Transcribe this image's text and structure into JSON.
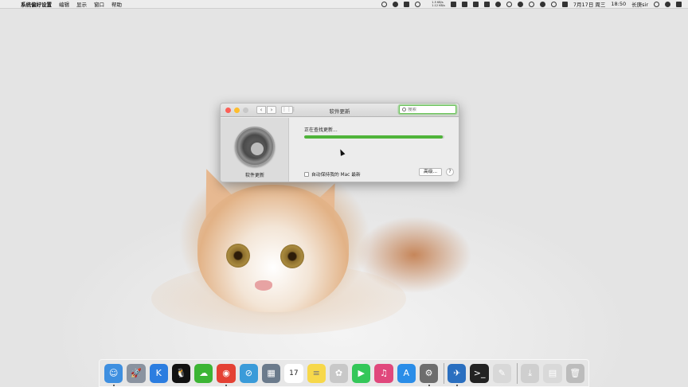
{
  "menubar": {
    "app_name": "系统偏好设置",
    "menus": [
      "编辑",
      "显示",
      "窗口",
      "帮助"
    ],
    "net_up": "1.5 KB/s",
    "net_down": "1.12 KB/s",
    "datetime": "7月17日 周三",
    "time": "18:50",
    "user": "长庚sir"
  },
  "window": {
    "title": "软件更新",
    "search_placeholder": "搜索",
    "pane_label": "软件更新",
    "status_text": "正在查找更新...",
    "progress": 0.99,
    "auto_update_label": "自动保持我的 Mac 最新",
    "advanced_label": "高级...",
    "help_label": "?"
  },
  "colors": {
    "progress_fill": "#4fb43a",
    "close": "#fc5f57",
    "minimize": "#fdbd2e"
  },
  "dock": {
    "items": [
      {
        "name": "finder-icon",
        "glyph": "☺",
        "color": "#3e8fe0",
        "running": true
      },
      {
        "name": "launchpad-icon",
        "glyph": "🚀",
        "color": "#8a93a0",
        "running": false
      },
      {
        "name": "klipper-icon",
        "glyph": "K",
        "color": "#2b7de0",
        "running": false
      },
      {
        "name": "qq-icon",
        "glyph": "🐧",
        "color": "#111111",
        "running": false
      },
      {
        "name": "wechat-icon",
        "glyph": "☁",
        "color": "#3cb534",
        "running": false
      },
      {
        "name": "chrome-icon",
        "glyph": "◉",
        "color": "#e44134",
        "running": true
      },
      {
        "name": "safari-icon",
        "glyph": "⊘",
        "color": "#3a9bd9",
        "running": false
      },
      {
        "name": "preview-icon",
        "glyph": "▦",
        "color": "#6b7b8c",
        "running": false
      },
      {
        "name": "calendar-icon",
        "glyph": "17",
        "color": "#ffffff",
        "running": false
      },
      {
        "name": "notes-icon",
        "glyph": "≡",
        "color": "#f7d84a",
        "running": false
      },
      {
        "name": "photos-icon",
        "glyph": "✿",
        "color": "#c8c8c8",
        "running": false
      },
      {
        "name": "facetime-icon",
        "glyph": "▶",
        "color": "#34c759",
        "running": false
      },
      {
        "name": "itunes-icon",
        "glyph": "♫",
        "color": "#e0487c",
        "running": false
      },
      {
        "name": "appstore-icon",
        "glyph": "A",
        "color": "#2a8de8",
        "running": false
      },
      {
        "name": "system-preferences-icon",
        "glyph": "⚙",
        "color": "#6d6d6d",
        "running": true
      },
      {
        "name": "sep"
      },
      {
        "name": "migration-icon",
        "glyph": "✈",
        "color": "#2a6fc0",
        "running": true
      },
      {
        "name": "terminal-icon",
        "glyph": ">_",
        "color": "#222222",
        "running": false
      },
      {
        "name": "textedit-icon",
        "glyph": "✎",
        "color": "#d8d8d8",
        "running": false
      },
      {
        "name": "sep"
      },
      {
        "name": "downloads-icon",
        "glyph": "⤓",
        "color": "#cfcfcf",
        "running": false
      },
      {
        "name": "documents-icon",
        "glyph": "▤",
        "color": "#d9d9d9",
        "running": false
      },
      {
        "name": "trash-icon",
        "glyph": "🗑",
        "color": "#bcbcbc",
        "running": false
      }
    ]
  }
}
